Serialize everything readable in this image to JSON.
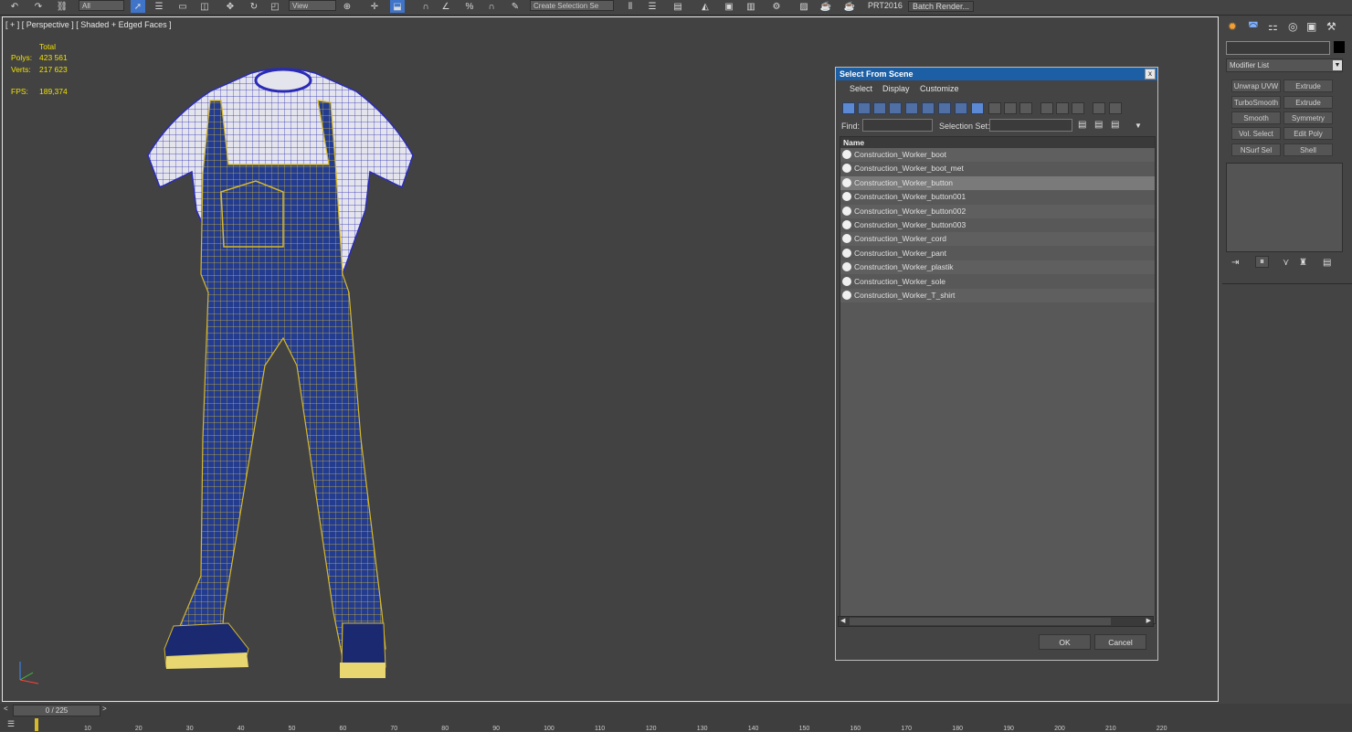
{
  "toolbar": {
    "selection_filter": "All",
    "view_dropdown": "View",
    "named_selection": "Create Selection Se",
    "prt_label": "PRT2016",
    "batch_render": "Batch Render..."
  },
  "viewport": {
    "label": "[ + ] [ Perspective ] [ Shaded + Edged Faces ]",
    "stats": {
      "total_label": "Total",
      "polys_label": "Polys:",
      "polys_value": "423 561",
      "verts_label": "Verts:",
      "verts_value": "217 623",
      "fps_label": "FPS:",
      "fps_value": "189,374"
    }
  },
  "dialog": {
    "title": "Select From Scene",
    "close": "x",
    "menu": [
      "Select",
      "Display",
      "Customize"
    ],
    "find_label": "Find:",
    "selection_set_label": "Selection Set:",
    "column_name": "Name",
    "items": [
      "Construction_Worker_boot",
      "Construction_Worker_boot_met",
      "Construction_Worker_button",
      "Construction_Worker_button001",
      "Construction_Worker_button002",
      "Construction_Worker_button003",
      "Construction_Worker_cord",
      "Construction_Worker_pant",
      "Construction_Worker_plastik",
      "Construction_Worker_sole",
      "Construction_Worker_T_shirt"
    ],
    "selected_index": 2,
    "ok": "OK",
    "cancel": "Cancel"
  },
  "command_panel": {
    "modifier_list": "Modifier List",
    "modifier_buttons": [
      "Unwrap UVW",
      "Extrude",
      "TurboSmooth",
      "Extrude",
      "Smooth",
      "Symmetry",
      "Vol. Select",
      "Edit Poly",
      "NSurf Sel",
      "Shell"
    ]
  },
  "timeline": {
    "frame_counter": "0 / 225",
    "ticks": [
      "10",
      "20",
      "30",
      "40",
      "50",
      "60",
      "70",
      "80",
      "90",
      "100",
      "110",
      "120",
      "130",
      "140",
      "150",
      "160",
      "170",
      "180",
      "190",
      "200",
      "210",
      "220"
    ]
  },
  "colors": {
    "overalls_blue": "#233c8f",
    "wire_yellow": "#d7b82a",
    "shirt_white": "#e4e4ec",
    "wire_blue": "#2a2ab8",
    "stats_yellow": "#f0e000",
    "title_blue": "#1c5fa5"
  }
}
